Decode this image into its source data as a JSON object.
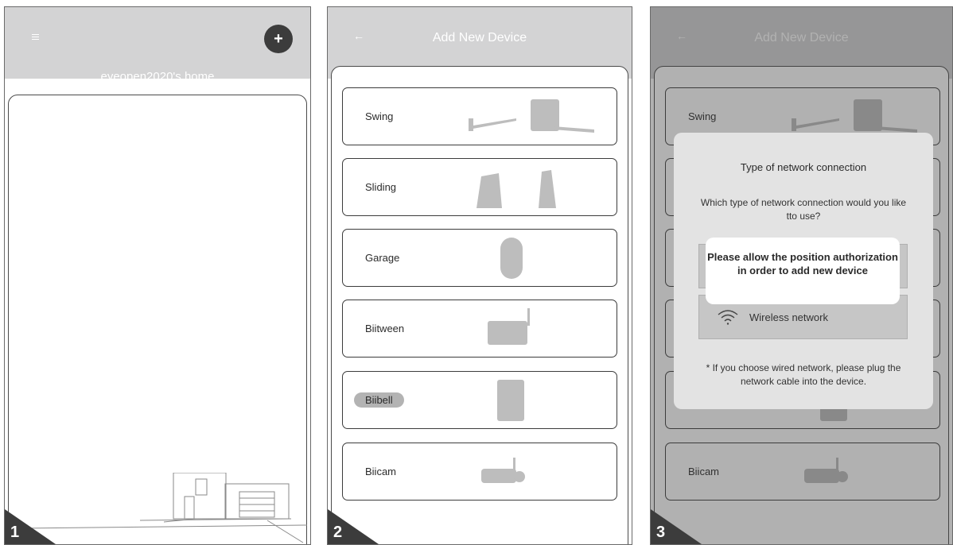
{
  "screen1": {
    "add_label": "+",
    "home_title": "eyeopen2020's home",
    "step": "1"
  },
  "screen2": {
    "back_label": "←",
    "title": "Add New Device",
    "devices": [
      {
        "label": "Swing",
        "icon": "swing-gate-icon"
      },
      {
        "label": "Sliding",
        "icon": "sliding-gate-icon"
      },
      {
        "label": "Garage",
        "icon": "garage-remote-icon"
      },
      {
        "label": "Biitween",
        "icon": "biitween-hub-icon"
      },
      {
        "label": "Biibell",
        "icon": "doorbell-icon"
      },
      {
        "label": "Biicam",
        "icon": "camera-icon"
      }
    ],
    "step": "2"
  },
  "screen3": {
    "back_label": "←",
    "title": "Add New Device",
    "visible_devices": [
      {
        "label": "Swing"
      },
      {
        "label": "Biicam"
      }
    ],
    "dialog": {
      "title": "Type of network connection",
      "question": "Which type of network connection would you like tto use?",
      "options": [
        {
          "label": "",
          "icon": "wired-icon"
        },
        {
          "label": "Wireless network",
          "icon": "wifi-icon"
        }
      ],
      "note": "* If you choose wired network, please plug the network cable into the device."
    },
    "toast": {
      "message": "Please allow the position authorization in order to add new device"
    },
    "step": "3"
  },
  "colors": {
    "header": "#d3d3d4",
    "dark": "#3c3c3c",
    "highlight": "#b3b3b3",
    "dialog": "#e3e3e3"
  }
}
